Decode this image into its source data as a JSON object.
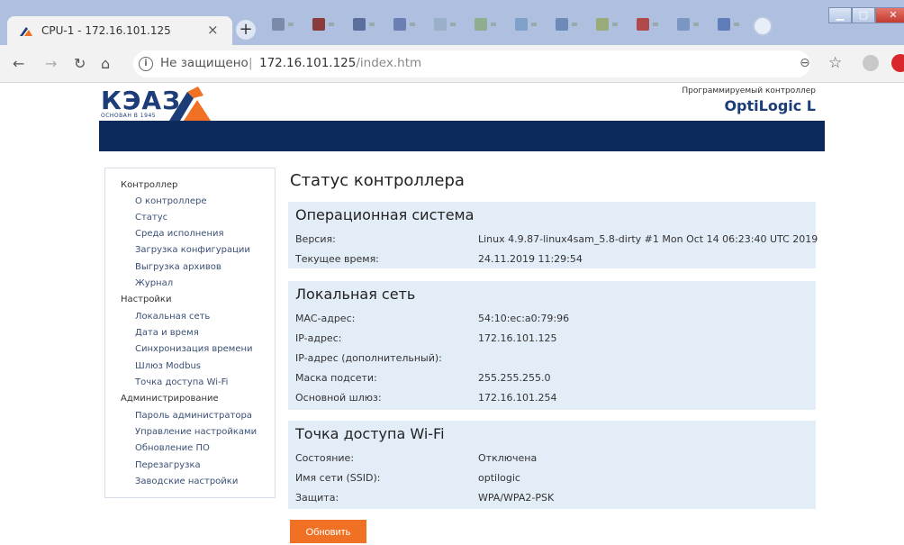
{
  "browser": {
    "tab_title": "CPU-1 - 172.16.101.125",
    "tab_close": "×",
    "new_tab": "+",
    "security_text": "Не защищено",
    "separator": "|",
    "url_host": "172.16.101.125",
    "url_path": "/index.htm"
  },
  "header": {
    "logo_text": "КЭАЗ",
    "logo_subtitle": "ОСНОВАН В 1945",
    "product_caption": "Программируемый контроллер",
    "product_name": "OptiLogic L"
  },
  "sidebar": {
    "groups": [
      {
        "label": "Контроллер",
        "items": [
          "О контроллере",
          "Статус",
          "Среда исполнения",
          "Загрузка конфигурации",
          "Выгрузка архивов",
          "Журнал"
        ]
      },
      {
        "label": "Настройки",
        "items": [
          "Локальная сеть",
          "Дата и время",
          "Синхронизация времени",
          "Шлюз Modbus",
          "Точка доступа Wi-Fi"
        ]
      },
      {
        "label": "Администрирование",
        "items": [
          "Пароль администратора",
          "Управление настройками",
          "Обновление ПО",
          "Перезагрузка",
          "Заводские настройки"
        ]
      }
    ]
  },
  "main": {
    "title": "Статус контроллера",
    "sections": [
      {
        "title": "Операционная система",
        "rows": [
          {
            "label": "Версия:",
            "value": "Linux 4.9.87-linux4sam_5.8-dirty #1 Mon Oct 14 06:23:40 UTC 2019"
          },
          {
            "label": "Текущее время:",
            "value": "24.11.2019 11:29:54"
          }
        ]
      },
      {
        "title": "Локальная сеть",
        "rows": [
          {
            "label": "MAC-адрес:",
            "value": "54:10:ec:a0:79:96"
          },
          {
            "label": "IP-адрес:",
            "value": "172.16.101.125"
          },
          {
            "label": "IP-адрес (дополнительный):",
            "value": ""
          },
          {
            "label": "Маска подсети:",
            "value": "255.255.255.0"
          },
          {
            "label": "Основной шлюз:",
            "value": "172.16.101.254"
          }
        ]
      },
      {
        "title": "Точка доступа Wi-Fi",
        "rows": [
          {
            "label": "Состояние:",
            "value": "Отключена"
          },
          {
            "label": "Имя сети (SSID):",
            "value": "optilogic"
          },
          {
            "label": "Защита:",
            "value": "WPA/WPA2-PSK"
          }
        ]
      }
    ],
    "refresh_label": "Обновить"
  },
  "colors": {
    "brand_navy": "#0c2a5c",
    "accent_orange": "#f07124",
    "panel_bg": "#e3edf8"
  }
}
